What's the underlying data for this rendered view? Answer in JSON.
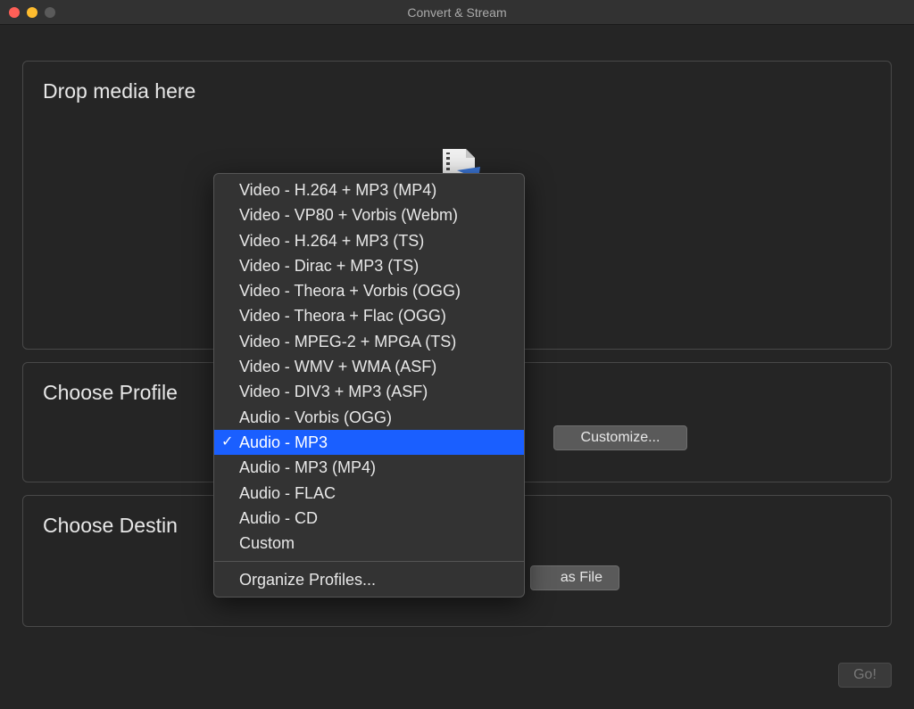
{
  "window": {
    "title": "Convert & Stream"
  },
  "drop": {
    "label": "Drop media here"
  },
  "profile": {
    "label": "Choose Profile",
    "customize_label": "Customize..."
  },
  "destination": {
    "label": "Choose Destin",
    "as_file_label": "as File"
  },
  "go_label": "Go!",
  "dropdown": {
    "items": [
      "Video - H.264 + MP3 (MP4)",
      "Video - VP80 + Vorbis (Webm)",
      "Video - H.264 + MP3 (TS)",
      "Video - Dirac + MP3 (TS)",
      "Video - Theora + Vorbis (OGG)",
      "Video - Theora + Flac (OGG)",
      "Video - MPEG-2 + MPGA (TS)",
      "Video - WMV + WMA (ASF)",
      "Video - DIV3 + MP3 (ASF)",
      "Audio - Vorbis (OGG)",
      "Audio - MP3",
      "Audio - MP3 (MP4)",
      "Audio - FLAC",
      "Audio - CD",
      "Custom"
    ],
    "selected_index": 10,
    "organize_label": "Organize Profiles..."
  }
}
